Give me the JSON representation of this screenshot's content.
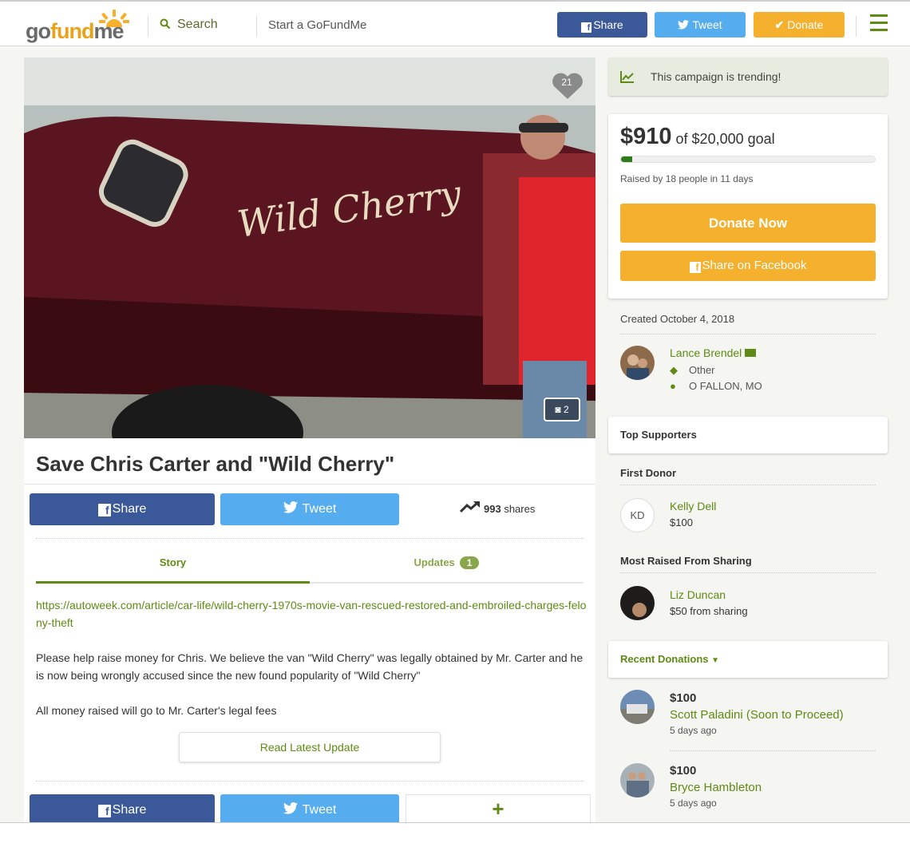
{
  "header": {
    "logo_go": "go",
    "logo_fund": "fund",
    "logo_me": "me",
    "search_label": "Search",
    "start_label": "Start a GoFundMe",
    "share_label": "Share",
    "tweet_label": "Tweet",
    "donate_label": "Donate"
  },
  "campaign": {
    "photo_count": "2",
    "heart_count": "21",
    "title": "Save Chris Carter and \"Wild Cherry\"",
    "share_label": "Share",
    "tweet_label": "Tweet",
    "shares_count": "993",
    "shares_label": "shares"
  },
  "tabs": {
    "story": "Story",
    "updates": "Updates",
    "updates_count": "1"
  },
  "story": {
    "link": "https://autoweek.com/article/car-life/wild-cherry-1970s-movie-van-rescued-restored-and-embroiled-charges-felony-theft",
    "paragraph1": "Please help raise money for Chris. We believe the van \"Wild Cherry\" was legally obtained by Mr. Carter and he is now being wrongly accused since the new found popularity of \"Wild Cherry\"",
    "paragraph2": "All money raised will go to Mr. Carter's legal fees",
    "read_latest": "Read Latest Update"
  },
  "bottom_share": {
    "share_label": "Share",
    "tweet_label": "Tweet",
    "plus": "+"
  },
  "sidebar": {
    "trending": "This campaign is trending!",
    "raised_amount": "$910",
    "goal_text": "of $20,000 goal",
    "progress_fraction": 0.0455,
    "raised_by": "Raised by 18 people in 11 days",
    "donate_now": "Donate Now",
    "share_facebook": "Share on Facebook",
    "created": "Created October 4, 2018",
    "organizer_name": "Lance Brendel",
    "category": "Other",
    "location": "O FALLON, MO",
    "top_supporters": "Top Supporters",
    "first_donor_heading": "First Donor",
    "first_donor_initials": "KD",
    "first_donor_name": "Kelly Dell",
    "first_donor_amount": "$100",
    "most_raised_heading": "Most Raised From Sharing",
    "most_raised_name": "Liz Duncan",
    "most_raised_amount": "$50 from sharing",
    "recent_donations": "Recent Donations",
    "donations": [
      {
        "amount": "$100",
        "name": "Scott Paladini (Soon to Proceed)",
        "ago": "5 days ago"
      },
      {
        "amount": "$100",
        "name": "Bryce Hambleton",
        "ago": "5 days ago"
      }
    ]
  },
  "colors": {
    "brand_green": "#5e8b14",
    "donate_orange": "#f5b02d",
    "facebook_blue": "#3b5998",
    "twitter_blue": "#55acee"
  }
}
